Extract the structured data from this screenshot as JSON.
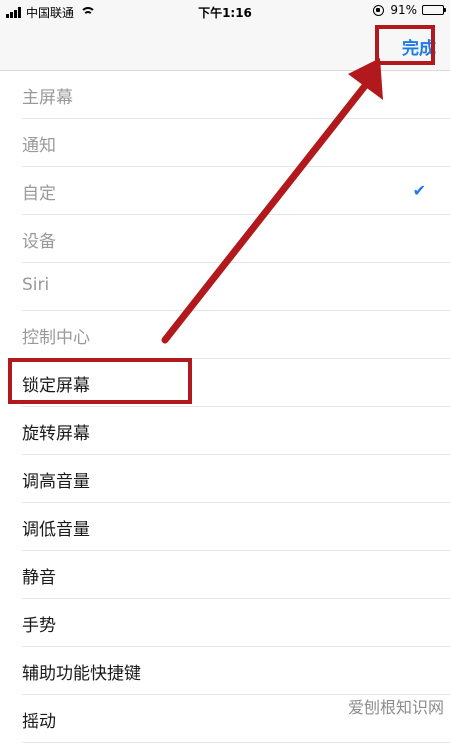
{
  "status": {
    "carrier": "中国联通",
    "time": "下午1:16",
    "battery": "91%"
  },
  "nav": {
    "done_label": "完成"
  },
  "items": [
    {
      "label": "主屏幕",
      "enabled": false
    },
    {
      "label": "通知",
      "enabled": false
    },
    {
      "label": "自定",
      "enabled": false,
      "checked": true
    },
    {
      "label": "设备",
      "enabled": false
    },
    {
      "label": "Siri",
      "enabled": false
    },
    {
      "label": "控制中心",
      "enabled": false
    },
    {
      "label": "锁定屏幕",
      "enabled": true
    },
    {
      "label": "旋转屏幕",
      "enabled": true
    },
    {
      "label": "调高音量",
      "enabled": true
    },
    {
      "label": "调低音量",
      "enabled": true
    },
    {
      "label": "静音",
      "enabled": true
    },
    {
      "label": "手势",
      "enabled": true
    },
    {
      "label": "辅助功能快捷键",
      "enabled": true
    },
    {
      "label": "摇动",
      "enabled": true
    }
  ],
  "watermark": "爱刨根知识网",
  "colors": {
    "accent": "#1e7ae6",
    "annotation": "#b2191d"
  }
}
